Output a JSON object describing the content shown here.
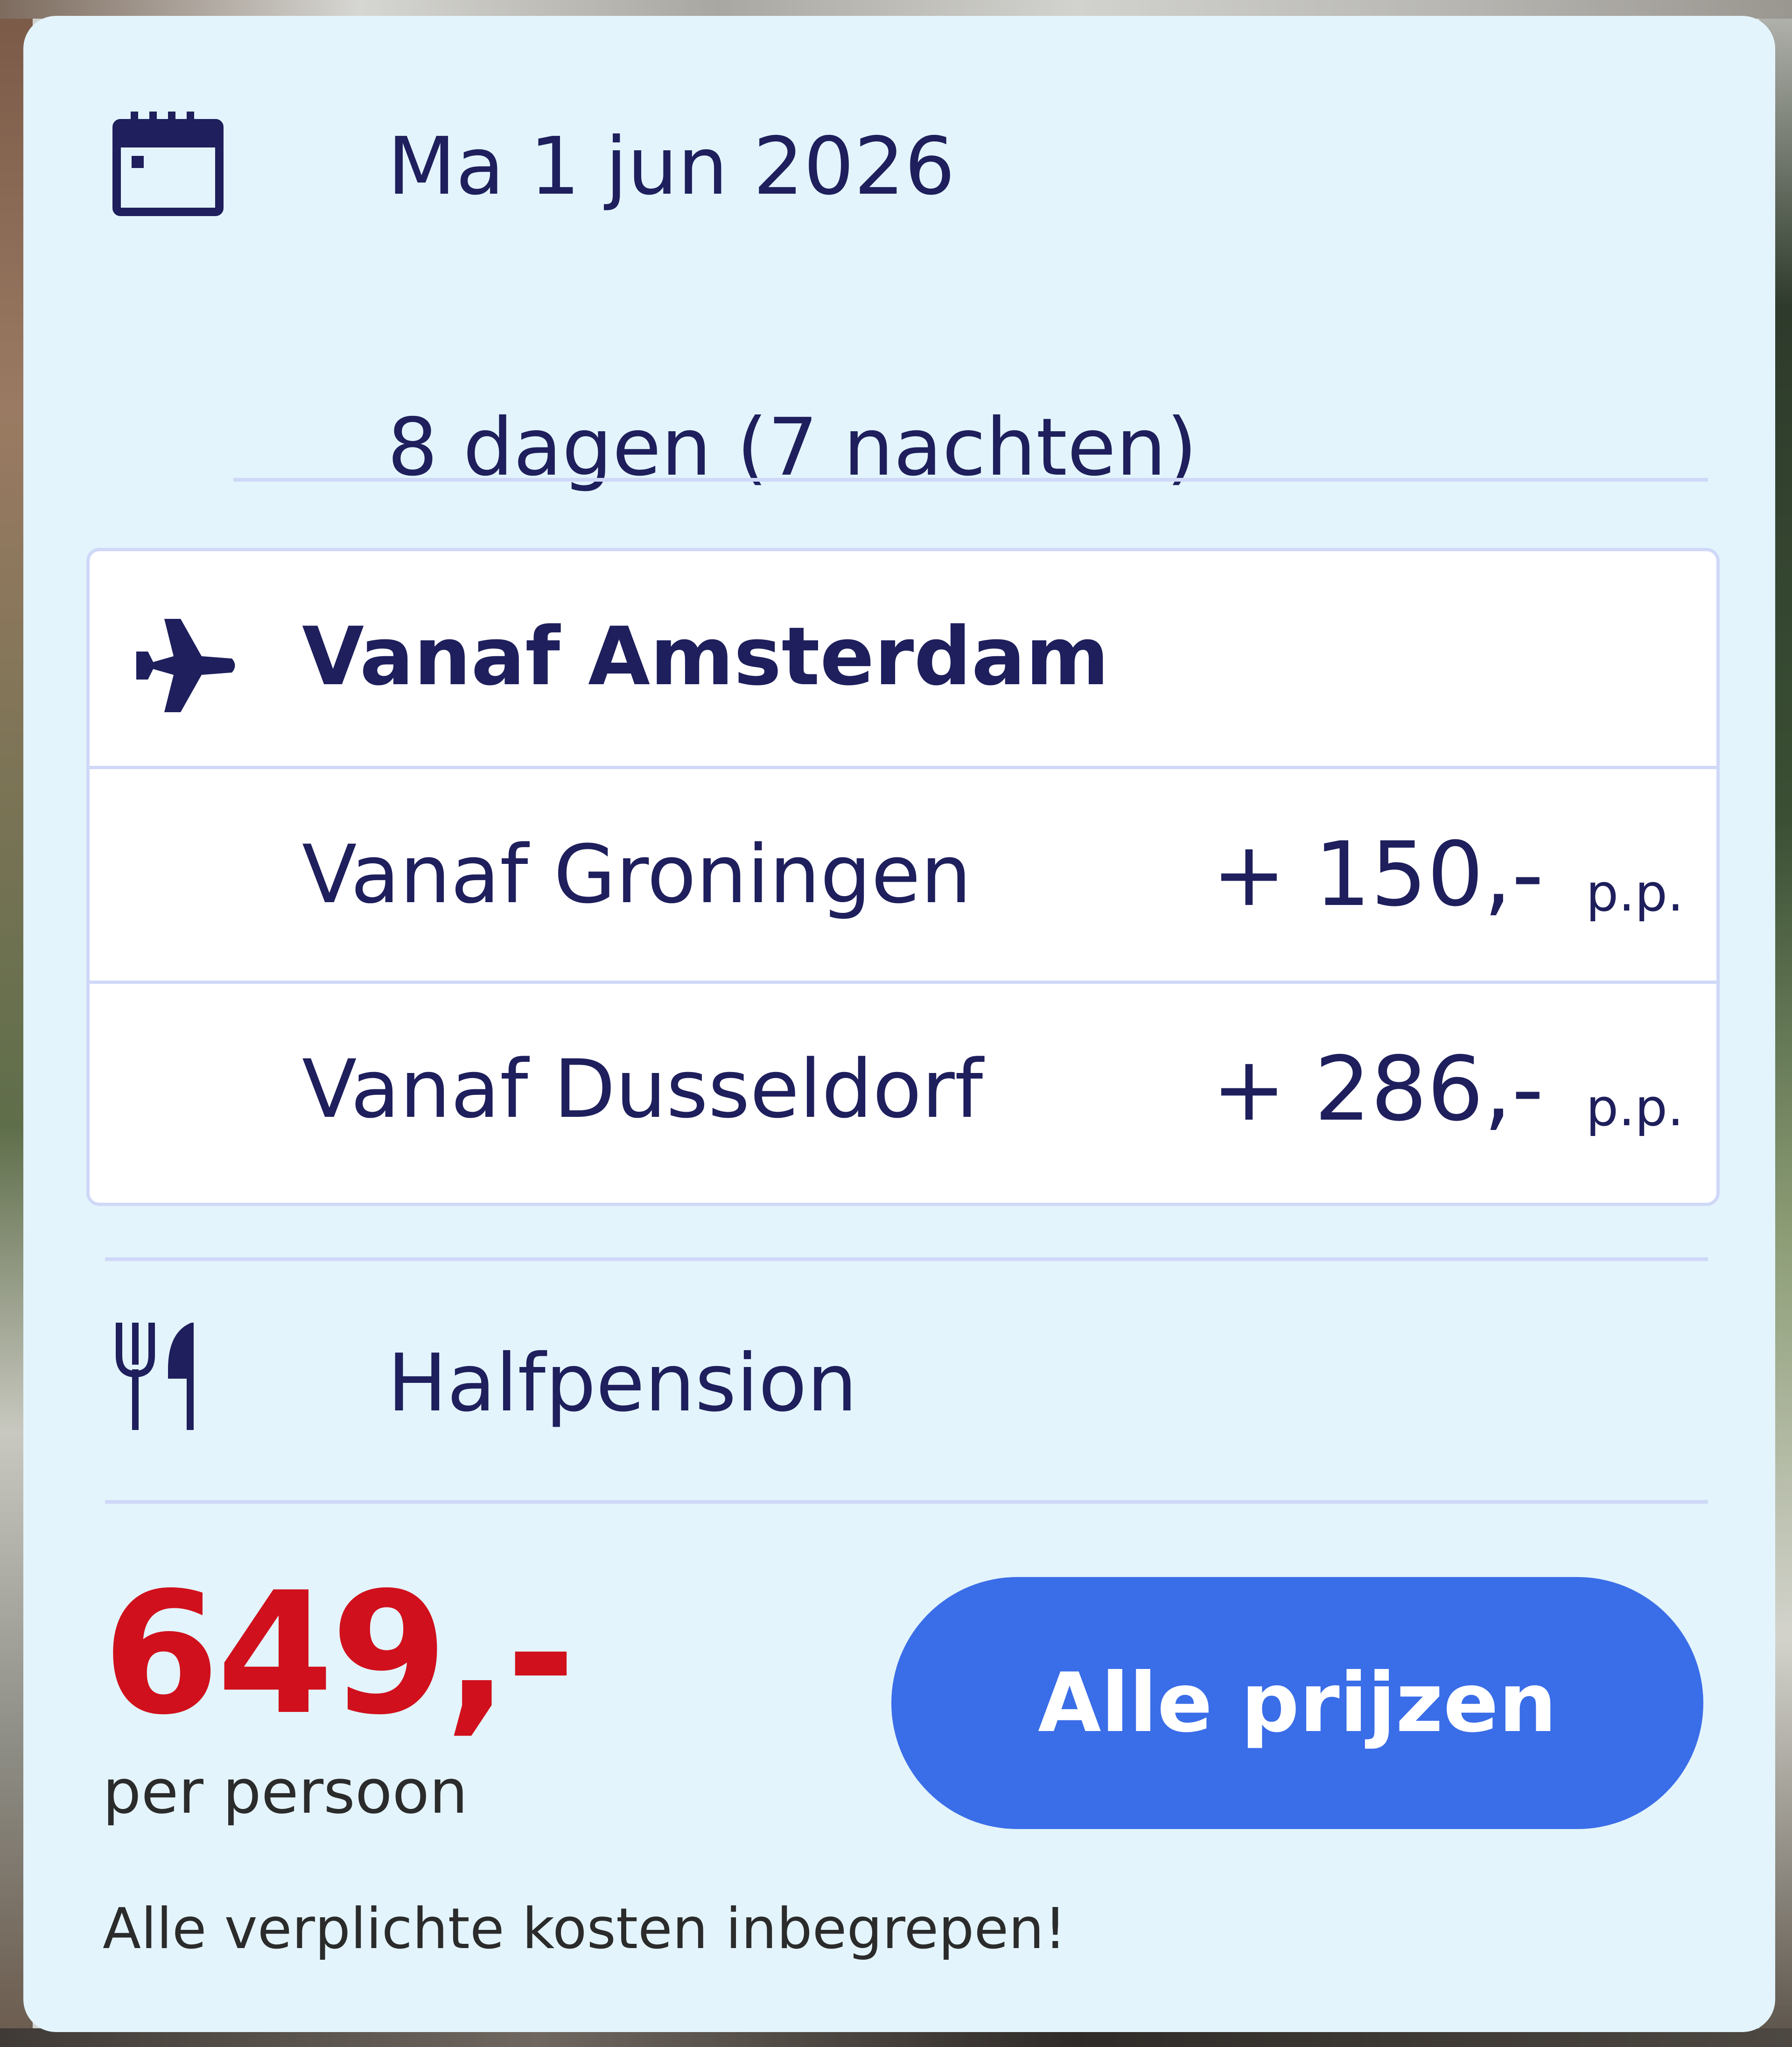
{
  "trip": {
    "date": "Ma 1 jun 2026",
    "duration": "8 dagen (7 nachten)"
  },
  "flights": [
    {
      "label": "Vanaf Amsterdam",
      "price": "",
      "unit": ""
    },
    {
      "label": "Vanaf Groningen",
      "price": "+ 150,-",
      "unit": "p.p."
    },
    {
      "label": "Vanaf Dusseldorf",
      "price": "+ 286,-",
      "unit": "p.p."
    }
  ],
  "meal": {
    "label": "Halfpension"
  },
  "pricing": {
    "price": "649,-",
    "per_person": "per persoon",
    "note": "Alle verplichte kosten inbegrepen!",
    "button_label": "Alle prijzen"
  },
  "icons": {
    "date": "calendar-icon",
    "flight": "airplane-icon",
    "meal": "fork-knife-icon"
  },
  "colors": {
    "card_background": "#e3f4fc",
    "text": "#1e1f5c",
    "price": "#d0101c",
    "button": "#3a6de8",
    "divider": "#cfd8f7"
  }
}
